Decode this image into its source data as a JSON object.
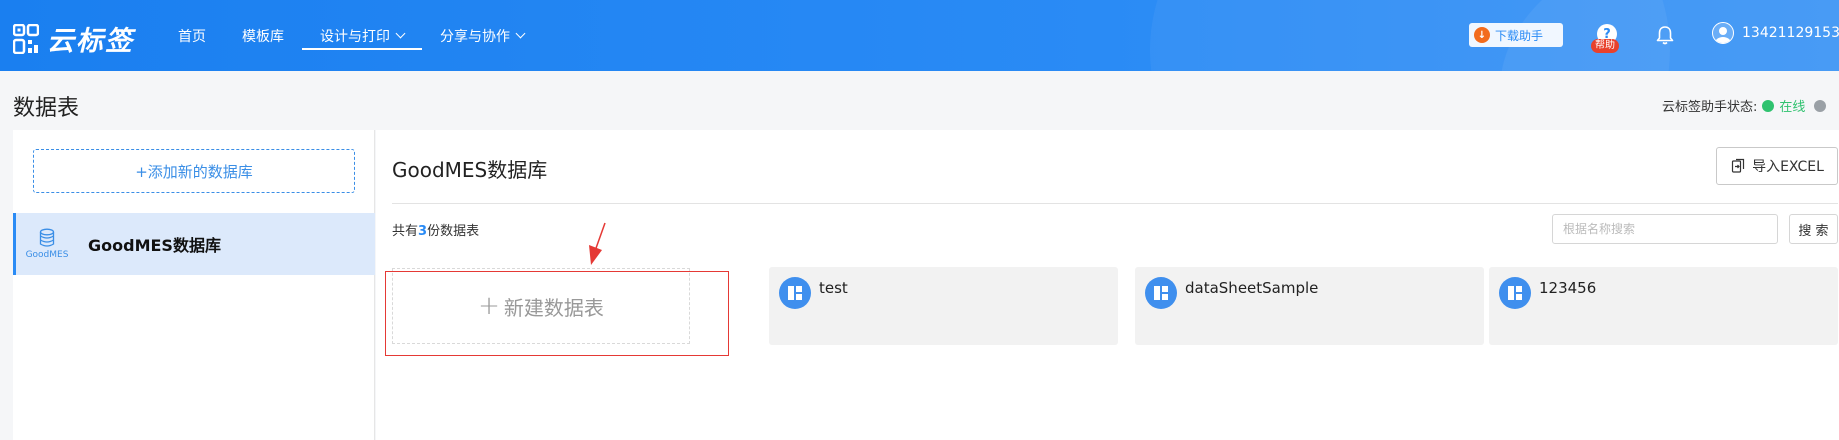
{
  "app": {
    "logo_text": "云标签"
  },
  "nav": {
    "items": [
      {
        "label": "首页",
        "dropdown": false,
        "active": false
      },
      {
        "label": "模板库",
        "dropdown": false,
        "active": false
      },
      {
        "label": "设计与打印",
        "dropdown": true,
        "active": true
      },
      {
        "label": "分享与协作",
        "dropdown": true,
        "active": false
      }
    ]
  },
  "header_right": {
    "download_label": "下载助手",
    "help_badge": "帮助",
    "help_glyph": "?",
    "username": "13421129153"
  },
  "page": {
    "title": "数据表",
    "assistant_status_label": "云标签助手状态:",
    "assistant_status_value": "在线"
  },
  "sidebar": {
    "add_button_label": "+添加新的数据库",
    "items": [
      {
        "name": "GoodMES数据库",
        "icon_label": "GoodMES",
        "selected": true
      }
    ]
  },
  "main": {
    "db_title": "GoodMES数据库",
    "import_label": "导入EXCEL",
    "count_prefix": "共有",
    "count_value": "3",
    "count_suffix": "份数据表",
    "search_placeholder": "根据名称搜索",
    "search_button": "搜 索",
    "new_table_label": "新建数据表",
    "tables": [
      {
        "name": "test"
      },
      {
        "name": "dataSheetSample"
      },
      {
        "name": "123456"
      }
    ]
  },
  "colors": {
    "primary": "#2a8bf5",
    "online": "#2fc26f",
    "highlight_red": "#e53935",
    "card_bg": "#f2f2f2"
  }
}
